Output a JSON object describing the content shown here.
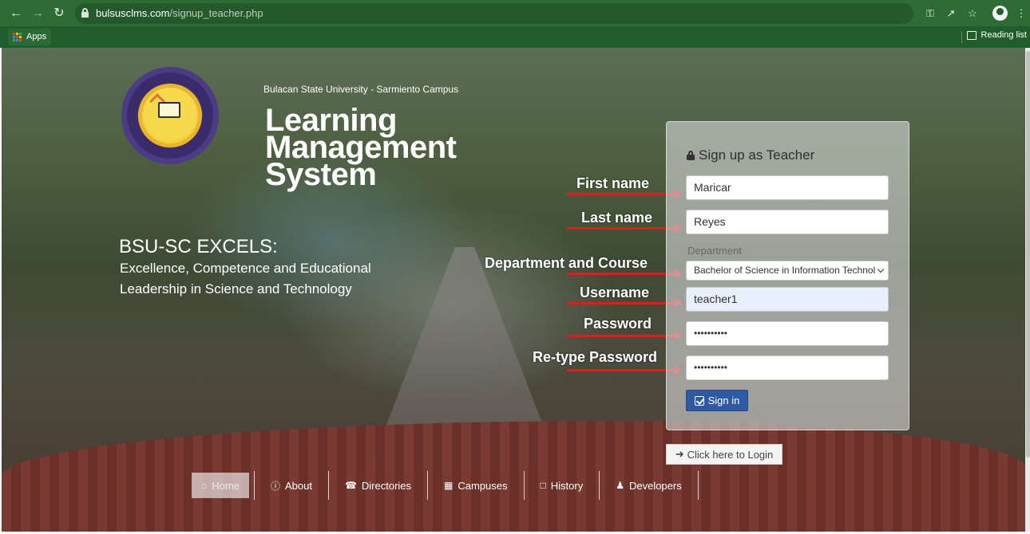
{
  "browser": {
    "url_host": "bulsusclms.com",
    "url_path": "/signup_teacher.php",
    "bookmarks_apps_label": "Apps",
    "reading_list_label": "Reading list",
    "colors": {
      "chrome": "#1f5e2c",
      "omnibox": "#24592b"
    },
    "icons": [
      "back-arrow-icon",
      "forward-arrow-icon",
      "reload-icon",
      "lock-icon",
      "key-icon",
      "share-icon",
      "star-icon",
      "profile-icon",
      "menu-dots-icon",
      "apps-grid-icon",
      "reading-list-icon"
    ]
  },
  "branding": {
    "campus_name": "Bulacan State University - Sarmiento Campus",
    "title_lines": [
      "Learning",
      "Management",
      "System"
    ],
    "motto_heading": "BSU-SC EXCELS:",
    "motto_line1": "Excellence, Competence and Educational",
    "motto_line2": "Leadership in Science and Technology"
  },
  "annotations": {
    "first_name": "First name",
    "last_name": "Last name",
    "department": "Department and Course",
    "username": "Username",
    "password": "Password",
    "retype_password": "Re-type Password",
    "arrow_color": "#e21b1b"
  },
  "form": {
    "title": "Sign up as Teacher",
    "first_name_value": "Maricar",
    "last_name_value": "Reyes",
    "department_label": "Department",
    "department_selected": "Bachelor of Science in Information Technol",
    "username_value": "teacher1",
    "password_value": "••••••••••",
    "retype_password_value": "••••••••••",
    "signin_label": "Sign in",
    "signin_color": "#2f5aa3"
  },
  "login_link": {
    "label": "Click here to Login"
  },
  "nav": [
    {
      "label": "Home",
      "icon": "home-icon"
    },
    {
      "label": "About",
      "icon": "info-icon"
    },
    {
      "label": "Directories",
      "icon": "phone-icon"
    },
    {
      "label": "Campuses",
      "icon": "building-icon"
    },
    {
      "label": "History",
      "icon": "document-icon"
    },
    {
      "label": "Developers",
      "icon": "user-icon"
    }
  ]
}
